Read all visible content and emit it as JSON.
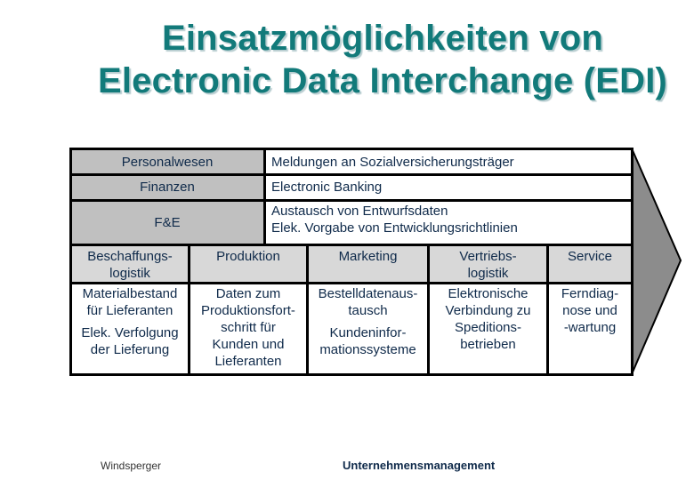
{
  "title": {
    "line1": "Einsatzmöglichkeiten von",
    "line2": "Electronic Data Interchange (EDI)"
  },
  "colors": {
    "title": "#127a7a",
    "text": "#0f2a4a",
    "support_gray": "#c0c0c0",
    "primary_header_gray": "#d8d8d8",
    "arrow_gray": "#8c8c8c"
  },
  "support_activities": [
    {
      "label": "Personalwesen",
      "uses": [
        "Meldungen an Sozialversicherungsträger"
      ]
    },
    {
      "label": "Finanzen",
      "uses": [
        "Electronic Banking"
      ]
    },
    {
      "label": "F&E",
      "uses": [
        "Austausch von Entwurfsdaten",
        "Elek. Vorgabe von Entwicklungsrichtlinien"
      ]
    }
  ],
  "primary_activities": [
    {
      "label_lines": [
        "Beschaffungs-",
        "logistik"
      ],
      "uses_lines": [
        "Materialbestand",
        "für Lieferanten",
        "",
        "Elek. Verfolgung",
        "der Lieferung"
      ]
    },
    {
      "label_lines": [
        "Produktion"
      ],
      "uses_lines": [
        "Daten zum",
        "Produktionsfort-",
        "schritt für",
        "Kunden und",
        "Lieferanten"
      ]
    },
    {
      "label_lines": [
        "Marketing"
      ],
      "uses_lines": [
        "Bestelldatenaus-",
        "tausch",
        "",
        "Kundeninfor-",
        "mationssysteme"
      ]
    },
    {
      "label_lines": [
        "Vertriebs-",
        "logistik"
      ],
      "uses_lines": [
        "Elektronische",
        "Verbindung zu",
        "Speditions-",
        "betrieben"
      ]
    },
    {
      "label_lines": [
        "Service"
      ],
      "uses_lines": [
        "Ferndiag-",
        "nose und",
        "-wartung"
      ]
    }
  ],
  "footer": {
    "author": "Windsperger",
    "topic": "Unternehmensmanagement"
  }
}
